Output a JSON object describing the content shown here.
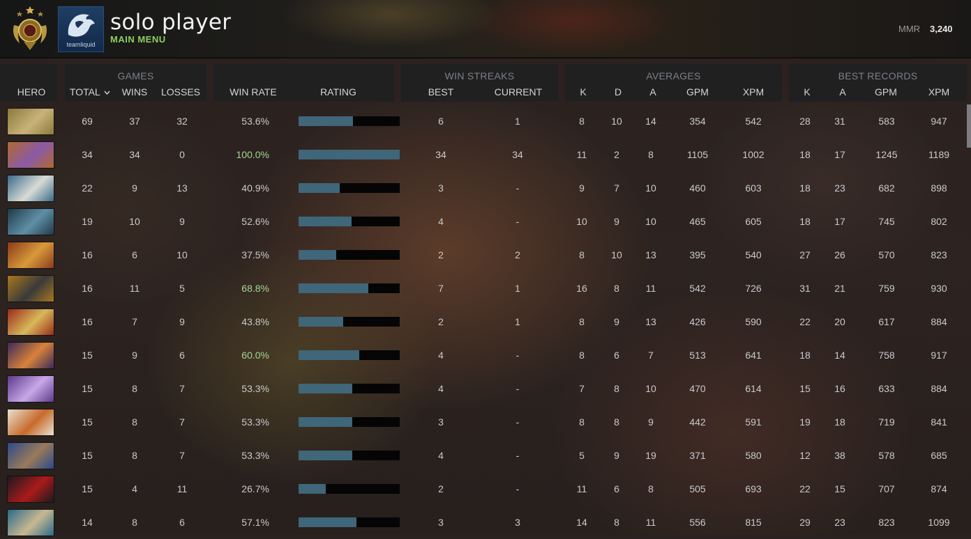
{
  "header": {
    "player_name": "solo player",
    "menu_link": "MAIN MENU",
    "team_logo_text": "teamliquid",
    "mmr_label": "MMR",
    "mmr_value": "3,240"
  },
  "groups": {
    "games": "GAMES",
    "win_streaks": "WIN STREAKS",
    "averages": "AVERAGES",
    "best_records": "BEST RECORDS"
  },
  "columns": {
    "hero": "HERO",
    "total": "TOTAL",
    "wins": "WINS",
    "losses": "LOSSES",
    "win_rate": "WIN RATE",
    "rating": "RATING",
    "best": "BEST",
    "current": "CURRENT",
    "avg_k": "K",
    "avg_d": "D",
    "avg_a": "A",
    "avg_gpm": "GPM",
    "avg_xpm": "XPM",
    "best_k": "K",
    "best_a": "A",
    "best_gpm": "GPM",
    "best_xpm": "XPM"
  },
  "icons": {
    "sort": "chevron-down-icon",
    "rank": "rank-medal-icon",
    "team": "team-liquid-logo"
  },
  "colors": {
    "bar_fill": "#3f6679",
    "bar_track": "#050505",
    "win_rate_high": "#a8d496",
    "menu_green": "#8fcf60"
  },
  "rows": [
    {
      "total": "69",
      "wins": "37",
      "losses": "32",
      "win_rate": "53.6%",
      "rating": 0.536,
      "best": "6",
      "current": "1",
      "avg_k": "8",
      "avg_d": "10",
      "avg_a": "14",
      "avg_gpm": "354",
      "avg_xpm": "542",
      "best_k": "28",
      "best_a": "31",
      "best_gpm": "583",
      "best_xpm": "947",
      "c1": "#8a7a3a",
      "c2": "#c9b27a"
    },
    {
      "total": "34",
      "wins": "34",
      "losses": "0",
      "win_rate": "100.0%",
      "rating": 1.0,
      "best": "34",
      "current": "34",
      "avg_k": "11",
      "avg_d": "2",
      "avg_a": "8",
      "avg_gpm": "1105",
      "avg_xpm": "1002",
      "best_k": "18",
      "best_a": "17",
      "best_gpm": "1245",
      "best_xpm": "1189",
      "c1": "#b06a2c",
      "c2": "#8a5aa8"
    },
    {
      "total": "22",
      "wins": "9",
      "losses": "13",
      "win_rate": "40.9%",
      "rating": 0.409,
      "best": "3",
      "current": "-",
      "avg_k": "9",
      "avg_d": "7",
      "avg_a": "10",
      "avg_gpm": "460",
      "avg_xpm": "603",
      "best_k": "18",
      "best_a": "23",
      "best_gpm": "682",
      "best_xpm": "898",
      "c1": "#3a6a8a",
      "c2": "#d8dcd6"
    },
    {
      "total": "19",
      "wins": "10",
      "losses": "9",
      "win_rate": "52.6%",
      "rating": 0.526,
      "best": "4",
      "current": "-",
      "avg_k": "10",
      "avg_d": "9",
      "avg_a": "10",
      "avg_gpm": "465",
      "avg_xpm": "605",
      "best_k": "18",
      "best_a": "17",
      "best_gpm": "745",
      "best_xpm": "802",
      "c1": "#1f3a48",
      "c2": "#5f8fa6"
    },
    {
      "total": "16",
      "wins": "6",
      "losses": "10",
      "win_rate": "37.5%",
      "rating": 0.375,
      "best": "2",
      "current": "2",
      "avg_k": "8",
      "avg_d": "10",
      "avg_a": "13",
      "avg_gpm": "395",
      "avg_xpm": "540",
      "best_k": "27",
      "best_a": "26",
      "best_gpm": "570",
      "best_xpm": "823",
      "c1": "#8a3a1a",
      "c2": "#d89a3a"
    },
    {
      "total": "16",
      "wins": "11",
      "losses": "5",
      "win_rate": "68.8%",
      "rating": 0.688,
      "best": "7",
      "current": "1",
      "avg_k": "16",
      "avg_d": "8",
      "avg_a": "11",
      "avg_gpm": "542",
      "avg_xpm": "726",
      "best_k": "31",
      "best_a": "21",
      "best_gpm": "759",
      "best_xpm": "930",
      "c1": "#a8781f",
      "c2": "#3a3a3a"
    },
    {
      "total": "16",
      "wins": "7",
      "losses": "9",
      "win_rate": "43.8%",
      "rating": 0.438,
      "best": "2",
      "current": "1",
      "avg_k": "8",
      "avg_d": "9",
      "avg_a": "13",
      "avg_gpm": "426",
      "avg_xpm": "590",
      "best_k": "22",
      "best_a": "20",
      "best_gpm": "617",
      "best_xpm": "884",
      "c1": "#9a2a1a",
      "c2": "#d8b85a"
    },
    {
      "total": "15",
      "wins": "9",
      "losses": "6",
      "win_rate": "60.0%",
      "rating": 0.6,
      "best": "4",
      "current": "-",
      "avg_k": "8",
      "avg_d": "6",
      "avg_a": "7",
      "avg_gpm": "513",
      "avg_xpm": "641",
      "best_k": "18",
      "best_a": "14",
      "best_gpm": "758",
      "best_xpm": "917",
      "c1": "#3a2a5a",
      "c2": "#d8823a"
    },
    {
      "total": "15",
      "wins": "8",
      "losses": "7",
      "win_rate": "53.3%",
      "rating": 0.533,
      "best": "4",
      "current": "-",
      "avg_k": "7",
      "avg_d": "8",
      "avg_a": "10",
      "avg_gpm": "470",
      "avg_xpm": "614",
      "best_k": "15",
      "best_a": "16",
      "best_gpm": "633",
      "best_xpm": "884",
      "c1": "#5a3a8a",
      "c2": "#c8a8e8"
    },
    {
      "total": "15",
      "wins": "8",
      "losses": "7",
      "win_rate": "53.3%",
      "rating": 0.533,
      "best": "3",
      "current": "-",
      "avg_k": "8",
      "avg_d": "8",
      "avg_a": "9",
      "avg_gpm": "442",
      "avg_xpm": "591",
      "best_k": "19",
      "best_a": "18",
      "best_gpm": "719",
      "best_xpm": "841",
      "c1": "#e8e2d2",
      "c2": "#c86a2a"
    },
    {
      "total": "15",
      "wins": "8",
      "losses": "7",
      "win_rate": "53.3%",
      "rating": 0.533,
      "best": "4",
      "current": "-",
      "avg_k": "5",
      "avg_d": "9",
      "avg_a": "19",
      "avg_gpm": "371",
      "avg_xpm": "580",
      "best_k": "12",
      "best_a": "38",
      "best_gpm": "578",
      "best_xpm": "685",
      "c1": "#2a4a8a",
      "c2": "#9a7a5a"
    },
    {
      "total": "15",
      "wins": "4",
      "losses": "11",
      "win_rate": "26.7%",
      "rating": 0.267,
      "best": "2",
      "current": "-",
      "avg_k": "11",
      "avg_d": "6",
      "avg_a": "8",
      "avg_gpm": "505",
      "avg_xpm": "693",
      "best_k": "22",
      "best_a": "15",
      "best_gpm": "707",
      "best_xpm": "874",
      "c1": "#1a1a1e",
      "c2": "#aa1a1a"
    },
    {
      "total": "14",
      "wins": "8",
      "losses": "6",
      "win_rate": "57.1%",
      "rating": 0.571,
      "best": "3",
      "current": "3",
      "avg_k": "14",
      "avg_d": "8",
      "avg_a": "11",
      "avg_gpm": "556",
      "avg_xpm": "815",
      "best_k": "29",
      "best_a": "23",
      "best_gpm": "823",
      "best_xpm": "1099",
      "c1": "#2a6a8a",
      "c2": "#c8b890"
    }
  ]
}
